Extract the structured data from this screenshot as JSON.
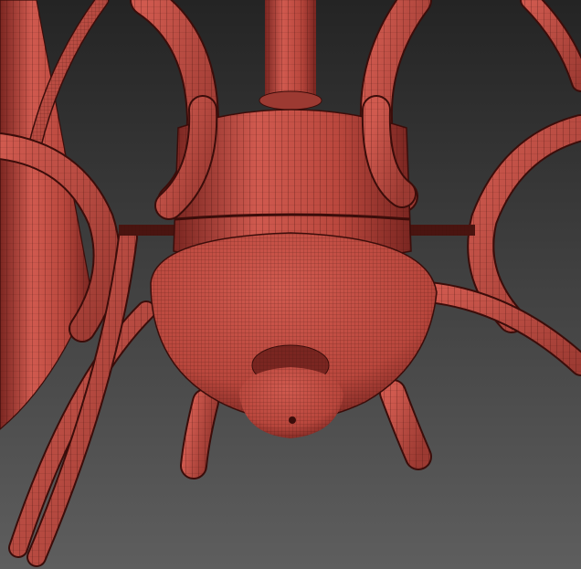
{
  "viewport": {
    "background_top": "#242424",
    "background_bottom": "#5e5e5e"
  },
  "model": {
    "shade_light": "#d05a4f",
    "shade_mid": "#b9473d",
    "shade_dark": "#7a2621",
    "wire_color": "#3b0d0a"
  }
}
